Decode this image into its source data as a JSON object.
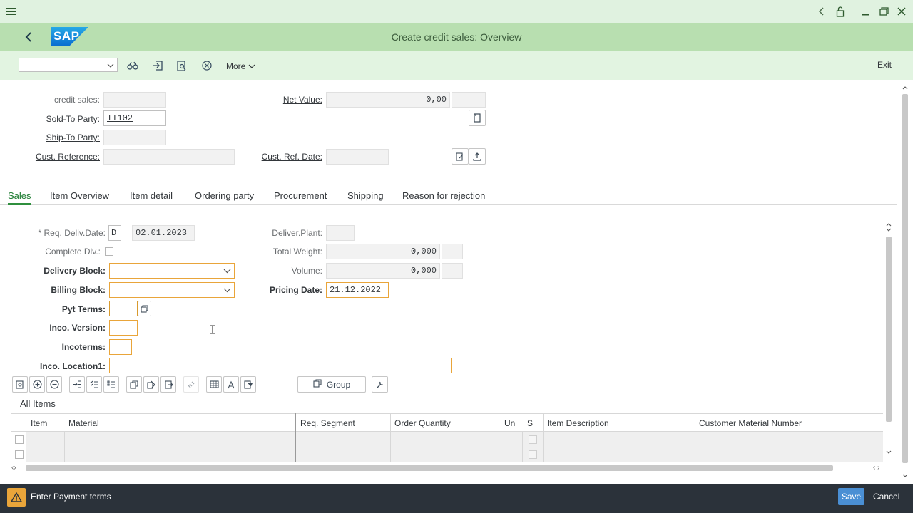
{
  "app": {
    "title": "Create credit sales: Overview",
    "logo_text": "SAP",
    "brand_color": "#0a6ed1"
  },
  "toolbar": {
    "dropdown_value": "",
    "more_label": "More",
    "exit_label": "Exit"
  },
  "header": {
    "credit_sales_label": "credit sales:",
    "credit_sales_value": "",
    "sold_to_label": "Sold-To Party:",
    "sold_to_value": "IT102",
    "ship_to_label": "Ship-To Party:",
    "ship_to_value": "",
    "cust_ref_label": "Cust. Reference:",
    "cust_ref_value": "",
    "net_value_label": "Net Value:",
    "net_value_value": "0,00",
    "net_value_currency": "",
    "cust_ref_date_label": "Cust. Ref. Date:",
    "cust_ref_date_value": ""
  },
  "tabs": [
    {
      "label": "Sales"
    },
    {
      "label": "Item Overview"
    },
    {
      "label": "Item detail"
    },
    {
      "label": "Ordering party"
    },
    {
      "label": "Procurement"
    },
    {
      "label": "Shipping"
    },
    {
      "label": "Reason for rejection"
    }
  ],
  "sales": {
    "req_deliv_label": "* Req. Deliv.Date:",
    "req_deliv_type": "D",
    "req_deliv_value": "02.01.2023",
    "complete_dlv_label": "Complete Dlv.:",
    "delivery_block_label": "Delivery Block:",
    "delivery_block_value": "",
    "billing_block_label": "Billing Block:",
    "billing_block_value": "",
    "pyt_terms_label": "Pyt Terms:",
    "pyt_terms_value": "",
    "inco_version_label": "Inco. Version:",
    "inco_version_value": "",
    "incoterms_label": "Incoterms:",
    "incoterms_value": "",
    "inco_location_label": "Inco. Location1:",
    "inco_location_value": "",
    "deliver_plant_label": "Deliver.Plant:",
    "deliver_plant_value": "",
    "total_weight_label": "Total Weight:",
    "total_weight_value": "0,000",
    "volume_label": "Volume:",
    "volume_value": "0,000",
    "pricing_date_label": "Pricing Date:",
    "pricing_date_value": "21.12.2022"
  },
  "items": {
    "group_button_label": "Group",
    "section_title": "All Items",
    "columns": [
      "Item",
      "Material",
      "Req. Segment",
      "Order Quantity",
      "Un",
      "S",
      "Item Description",
      "Customer Material Number"
    ]
  },
  "status": {
    "message": "Enter Payment terms",
    "save_label": "Save",
    "cancel_label": "Cancel"
  }
}
